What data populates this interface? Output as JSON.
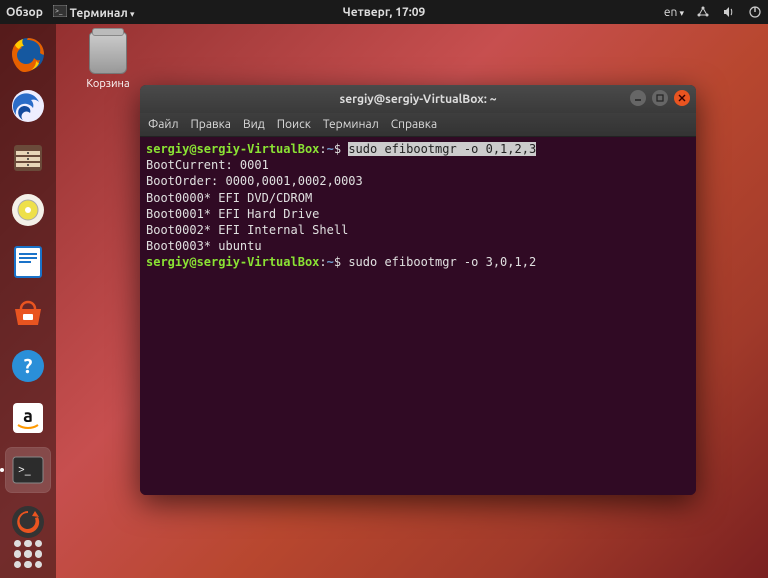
{
  "top_panel": {
    "overview": "Обзор",
    "active_app": "Терминал",
    "clock": "Четверг, 17:09",
    "lang": "en"
  },
  "desktop": {
    "trash_label": "Корзина"
  },
  "terminal": {
    "title": "sergiy@sergiy-VirtualBox: ~",
    "menu": {
      "file": "Файл",
      "edit": "Правка",
      "view": "Вид",
      "search": "Поиск",
      "terminal": "Терминал",
      "help": "Справка"
    },
    "prompt": {
      "userhost": "sergiy@sergiy-VirtualBox",
      "colon": ":",
      "path": "~",
      "sigil": "$"
    },
    "cmd1": "sudo efibootmgr -o 0,1,2,3",
    "output": {
      "l1": "BootCurrent: 0001",
      "l2": "BootOrder: 0000,0001,0002,0003",
      "l3": "Boot0000* EFI DVD/CDROM",
      "l4": "Boot0001* EFI Hard Drive",
      "l5": "Boot0002* EFI Internal Shell",
      "l6": "Boot0003* ubuntu"
    },
    "cmd2": "sudo efibootmgr -o 3,0,1,2"
  }
}
